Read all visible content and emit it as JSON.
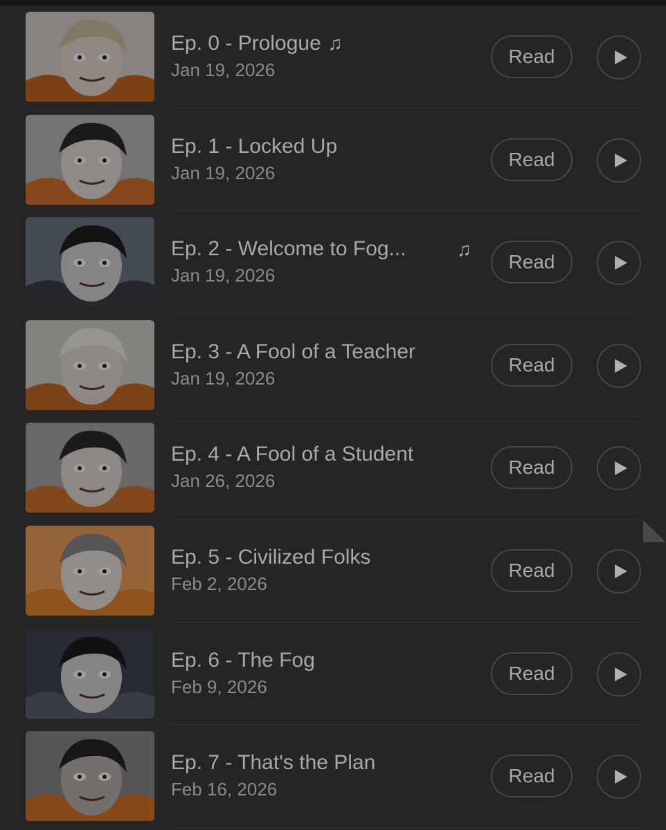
{
  "episodes": [
    {
      "title": "Ep. 0 - Prologue",
      "date": "Jan 19, 2026",
      "music": "inline",
      "music_icon": "music-note-icon",
      "read_label": "Read",
      "thumb": {
        "bg": "#d9d4cf",
        "accent": "#c96a1f",
        "hair": "#cfc3a0",
        "skin": "#e8ddd3"
      }
    },
    {
      "title": "Ep. 1 - Locked Up",
      "date": "Jan 19, 2026",
      "music": "none",
      "read_label": "Read",
      "thumb": {
        "bg": "#bdbab6",
        "accent": "#d8752a",
        "hair": "#2a2a2a",
        "skin": "#e6dfd8"
      }
    },
    {
      "title": "Ep. 2 - Welcome to Fog...",
      "date": "Jan 19, 2026",
      "music": "right",
      "music_icon": "music-note-icon",
      "read_label": "Read",
      "thumb": {
        "bg": "#6f7a86",
        "accent": "#3e3f44",
        "hair": "#1f1f22",
        "skin": "#d8d6d4"
      }
    },
    {
      "title": "Ep. 3 - A Fool of a Teacher",
      "date": "Jan 19, 2026",
      "music": "none",
      "read_label": "Read",
      "thumb": {
        "bg": "#d6d3cf",
        "accent": "#c86b22",
        "hair": "#f2f0ec",
        "skin": "#e5ded6"
      }
    },
    {
      "title": "Ep. 4 - A Fool of a Student",
      "date": "Jan 26, 2026",
      "music": "none",
      "read_label": "Read",
      "thumb": {
        "bg": "#a9a9ab",
        "accent": "#d2742c",
        "hair": "#2c2c2e",
        "skin": "#e3dcd4"
      }
    },
    {
      "title": "Ep. 5 - Civilized Folks",
      "date": "Feb 2, 2026",
      "music": "none",
      "read_label": "Read",
      "thumb": {
        "bg": "#f0a25a",
        "accent": "#e6872f",
        "hair": "#8a8a8a",
        "skin": "#ebe4dc"
      }
    },
    {
      "title": "Ep. 6 - The Fog",
      "date": "Feb 9, 2026",
      "music": "none",
      "read_label": "Read",
      "thumb": {
        "bg": "#3f4550",
        "accent": "#5a6270",
        "hair": "#1c1c1f",
        "skin": "#d9d7d5"
      }
    },
    {
      "title": "Ep. 7 - That's the Plan",
      "date": "Feb 16, 2026",
      "music": "none",
      "read_label": "Read",
      "thumb": {
        "bg": "#8e8a8a",
        "accent": "#d8782a",
        "hair": "#262626",
        "skin": "#b9b4af"
      }
    }
  ],
  "colors": {
    "background": "#252525",
    "text": "#a9a9a9",
    "muted": "#8a8a8a",
    "button_border": "#474747"
  }
}
